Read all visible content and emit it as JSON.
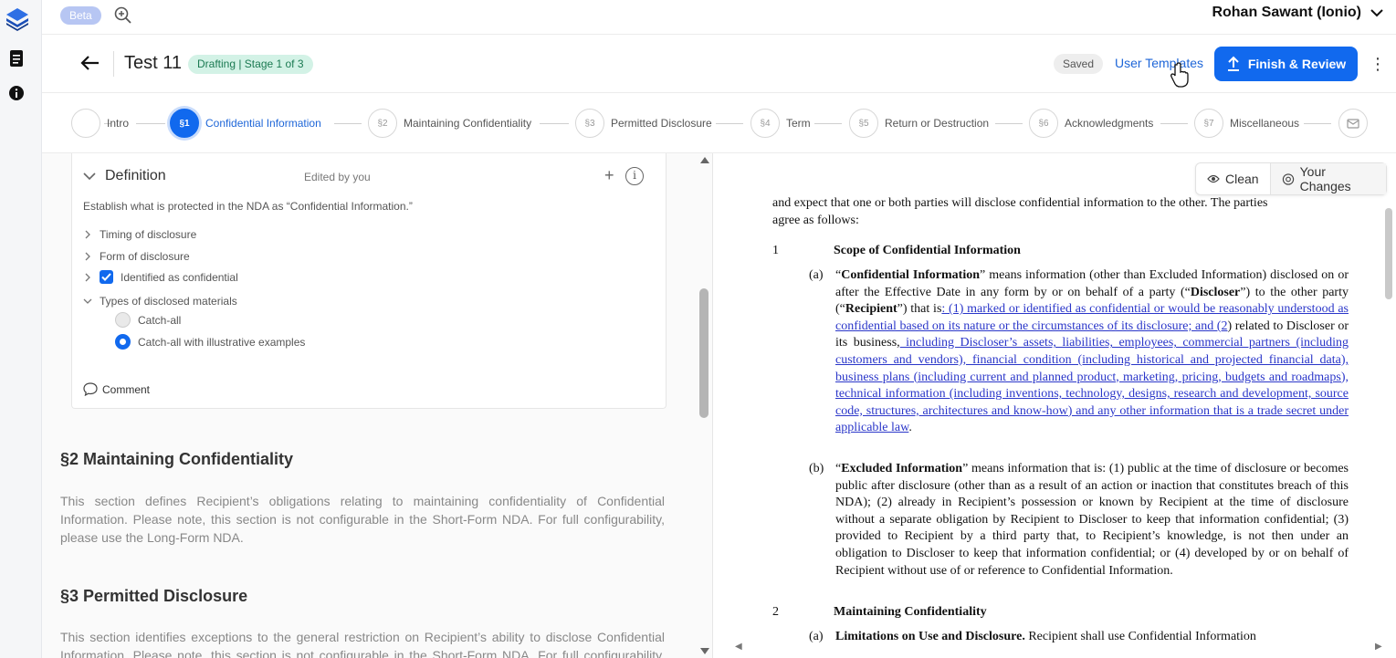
{
  "topbar": {
    "beta": "Beta",
    "user_name": "Rohan Sawant (Ionio)"
  },
  "header": {
    "doc_title": "Test 11",
    "stage_badge": "Drafting | Stage 1 of 3",
    "saved": "Saved",
    "user_templates": "User Templates",
    "finish_review": "Finish & Review"
  },
  "steps": [
    {
      "num": "",
      "label": "Intro"
    },
    {
      "num": "§1",
      "label": "Confidential Information"
    },
    {
      "num": "§2",
      "label": "Maintaining Confidentiality"
    },
    {
      "num": "§3",
      "label": "Permitted Disclosure"
    },
    {
      "num": "§4",
      "label": "Term"
    },
    {
      "num": "§5",
      "label": "Return or Destruction"
    },
    {
      "num": "§6",
      "label": "Acknowledgments"
    },
    {
      "num": "§7",
      "label": "Miscellaneous"
    }
  ],
  "definition": {
    "title": "Definition",
    "edited": "Edited by you",
    "description": "Establish what is protected in the NDA as “Confidential Information.”",
    "options": {
      "timing": "Timing of disclosure",
      "form": "Form of disclosure",
      "identified": "Identified as confidential",
      "types": "Types of disclosed materials"
    },
    "radios": {
      "catch_all": "Catch-all",
      "catch_all_examples": "Catch-all with illustrative examples"
    },
    "comment": "Comment"
  },
  "sections": {
    "s2_title": "§2 Maintaining Confidentiality",
    "s2_text": "This section defines Recipient’s obligations relating to maintaining confidentiality of Confidential Information. Please note, this section is not configurable in the Short-Form NDA. For full configurability, please use the Long-Form NDA.",
    "s3_title": "§3 Permitted Disclosure",
    "s3_text": "This section identifies exceptions to the general restriction on Recipient’s ability to disclose Confidential Information. Please note, this section is not configurable in the Short-Form NDA. For full configurability, please use the Long-Form NDA."
  },
  "view_toggle": {
    "clean": "Clean",
    "changes": "Your Changes"
  },
  "document": {
    "intro_cut": "and expect that one or both parties will disclose confidential information to the other. The parties",
    "intro_end": "agree as follows:",
    "clause1_num": "1",
    "clause1_title": "Scope of Confidential Information",
    "a_label": "(a)",
    "a_term": "Confidential Information",
    "a_text1": "” means information (other than Excluded Information) disclosed on or after the Effective Date in any form by or on behalf of a party (“",
    "a_disc": "Discloser",
    "a_text2": "”) to the other party (“",
    "a_recip": "Recipient",
    "a_text3": "”) that is",
    "a_ins1": ": (1) marked or identified as confidential or would be reasonably understood as confidential based on its nature or the circumstances of its disclosure; and (2",
    "a_text4": ") related to Discloser or its business,",
    "a_ins2": " including Discloser’s assets, liabilities, employees, commercial partners (including customers and vendors), financial condition (including historical and projected financial data), business plans (including current and planned product, marketing, pricing, budgets and roadmaps), technical information (including inventions, technology, designs, research and development, source code, structures, architectures and know-how) and any other information that is a trade secret under applicable law",
    "a_end": ".",
    "b_label": "(b)",
    "b_term": "Excluded Information",
    "b_text": "” means information that is: (1) public at the time of disclosure or becomes public after disclosure (other than as a result of an action or inaction that constitutes breach of this NDA); (2) already in Recipient’s possession or known by Recipient at the time of disclosure without a separate obligation by Recipient to Discloser to keep that information confidential; (3) provided to Recipient by a third party that, to Recipient’s knowledge, is not then under an obligation to Discloser to keep that information confidential; or (4) developed by or on behalf of Recipient without use of or reference to Confidential Information.",
    "clause2_num": "2",
    "clause2_title": "Maintaining Confidentiality",
    "c2a_label": "(a)",
    "c2a_term": "Limitations on Use and Disclosure.",
    "c2a_text": " Recipient shall use Confidential Information"
  },
  "colors": {
    "primary": "#1169ee",
    "insert": "#2a36c9",
    "stage_bg": "#d3f2e6",
    "stage_text": "#1b7a52"
  }
}
